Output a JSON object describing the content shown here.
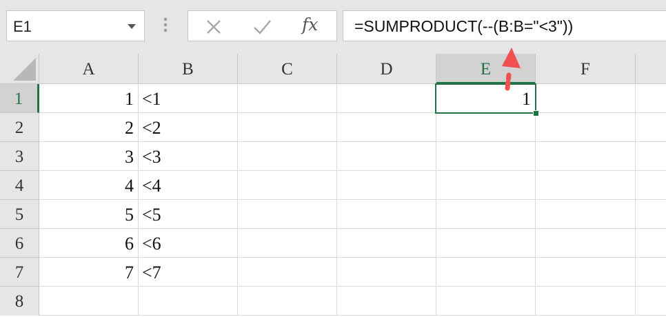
{
  "formula_bar": {
    "name_box": "E1",
    "cancel_icon": "cancel-x-icon",
    "enter_icon": "checkmark-icon",
    "fx_label": "fx",
    "formula": "=SUMPRODUCT(--(B:B=\"<3\"))"
  },
  "columns": [
    "A",
    "B",
    "C",
    "D",
    "E",
    "F"
  ],
  "rows": [
    "1",
    "2",
    "3",
    "4",
    "5",
    "6",
    "7",
    "8"
  ],
  "cells": {
    "A": [
      "1",
      "2",
      "3",
      "4",
      "5",
      "6",
      "7"
    ],
    "B": [
      "<1",
      "<2",
      "<3",
      "<4",
      "<5",
      "<6",
      "<7"
    ],
    "E1": "1"
  },
  "selected_cell": "E1",
  "colors": {
    "accent": "#217346",
    "annotation_arrow": "#f05050"
  }
}
